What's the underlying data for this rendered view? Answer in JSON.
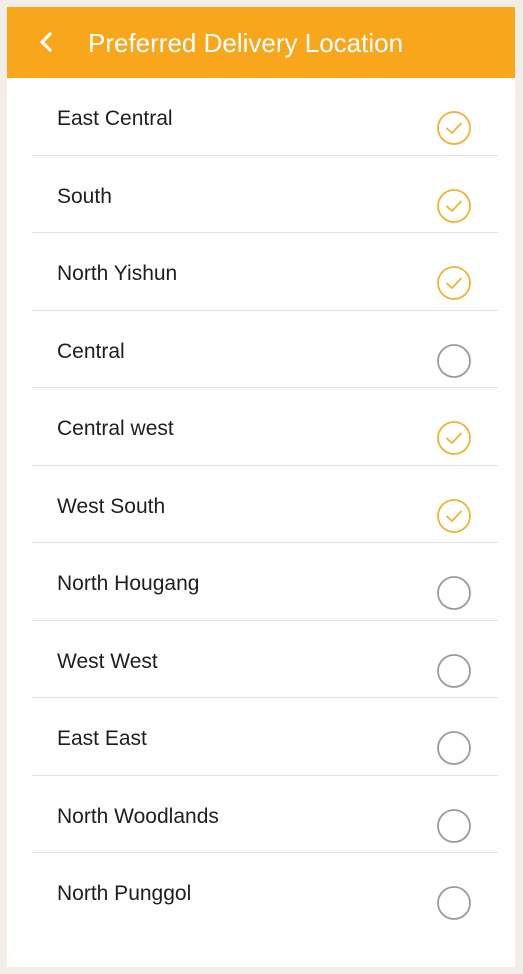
{
  "header": {
    "title": "Preferred Delivery Location",
    "back_icon": "chevron-left-icon"
  },
  "colors": {
    "accent": "#f8a71d",
    "checked": "#f2b233",
    "unchecked": "#9b9b9b"
  },
  "locations": [
    {
      "label": "East Central",
      "selected": true
    },
    {
      "label": "South",
      "selected": true
    },
    {
      "label": "North Yishun",
      "selected": true
    },
    {
      "label": "Central",
      "selected": false
    },
    {
      "label": "Central west",
      "selected": true
    },
    {
      "label": "West South",
      "selected": true
    },
    {
      "label": "North Hougang",
      "selected": false
    },
    {
      "label": "West West",
      "selected": false
    },
    {
      "label": "East East",
      "selected": false
    },
    {
      "label": "North Woodlands",
      "selected": false
    },
    {
      "label": "North Punggol",
      "selected": false
    }
  ]
}
